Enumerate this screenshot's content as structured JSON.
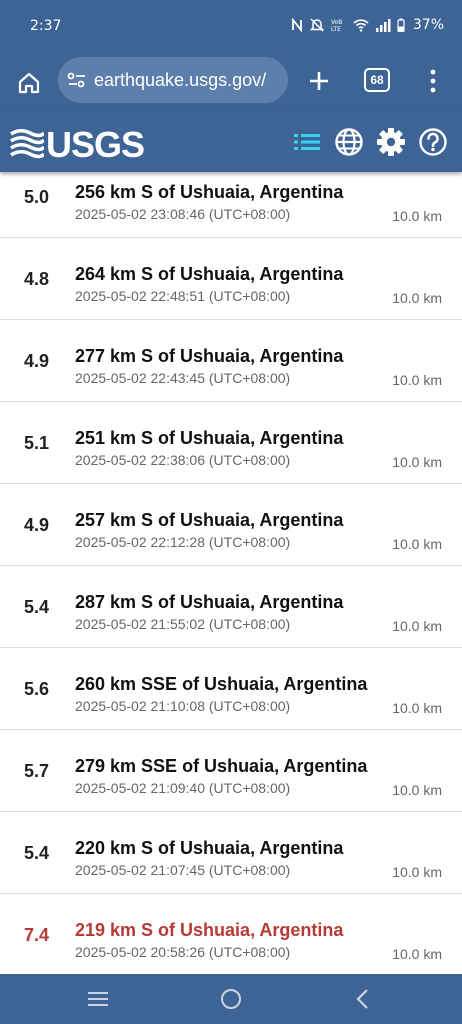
{
  "status_bar": {
    "time": "2:37",
    "battery": "37%"
  },
  "browser": {
    "url": "earthquake.usgs.gov/",
    "tab_count": "68"
  },
  "header": {
    "logo_text": "USGS"
  },
  "events": [
    {
      "mag": "5.0",
      "place": "256 km S of Ushuaia, Argentina",
      "time": "2025-05-02 23:08:46 (UTC+08:00)",
      "depth": "10.0 km"
    },
    {
      "mag": "4.8",
      "place": "264 km S of Ushuaia, Argentina",
      "time": "2025-05-02 22:48:51 (UTC+08:00)",
      "depth": "10.0 km"
    },
    {
      "mag": "4.9",
      "place": "277 km S of Ushuaia, Argentina",
      "time": "2025-05-02 22:43:45 (UTC+08:00)",
      "depth": "10.0 km"
    },
    {
      "mag": "5.1",
      "place": "251 km S of Ushuaia, Argentina",
      "time": "2025-05-02 22:38:06 (UTC+08:00)",
      "depth": "10.0 km"
    },
    {
      "mag": "4.9",
      "place": "257 km S of Ushuaia, Argentina",
      "time": "2025-05-02 22:12:28 (UTC+08:00)",
      "depth": "10.0 km"
    },
    {
      "mag": "5.4",
      "place": "287 km S of Ushuaia, Argentina",
      "time": "2025-05-02 21:55:02 (UTC+08:00)",
      "depth": "10.0 km"
    },
    {
      "mag": "5.6",
      "place": "260 km SSE of Ushuaia, Argentina",
      "time": "2025-05-02 21:10:08 (UTC+08:00)",
      "depth": "10.0 km"
    },
    {
      "mag": "5.7",
      "place": "279 km SSE of Ushuaia, Argentina",
      "time": "2025-05-02 21:09:40 (UTC+08:00)",
      "depth": "10.0 km"
    },
    {
      "mag": "5.4",
      "place": "220 km S of Ushuaia, Argentina",
      "time": "2025-05-02 21:07:45 (UTC+08:00)",
      "depth": "10.0 km"
    },
    {
      "mag": "7.4",
      "place": "219 km S of Ushuaia, Argentina",
      "time": "2025-05-02 20:58:26 (UTC+08:00)",
      "depth": "10.0 km"
    }
  ],
  "colors": {
    "header_bg": "#3e6496",
    "major_event": "#b83a35",
    "list_icon_accent": "#37d2f0"
  },
  "icons": {
    "home": "home-icon",
    "site_settings": "tune-icon",
    "new_tab": "plus-icon",
    "menu": "more-vert-icon",
    "list": "list-icon",
    "map": "globe-icon",
    "settings": "gear-icon",
    "help": "help-icon"
  }
}
